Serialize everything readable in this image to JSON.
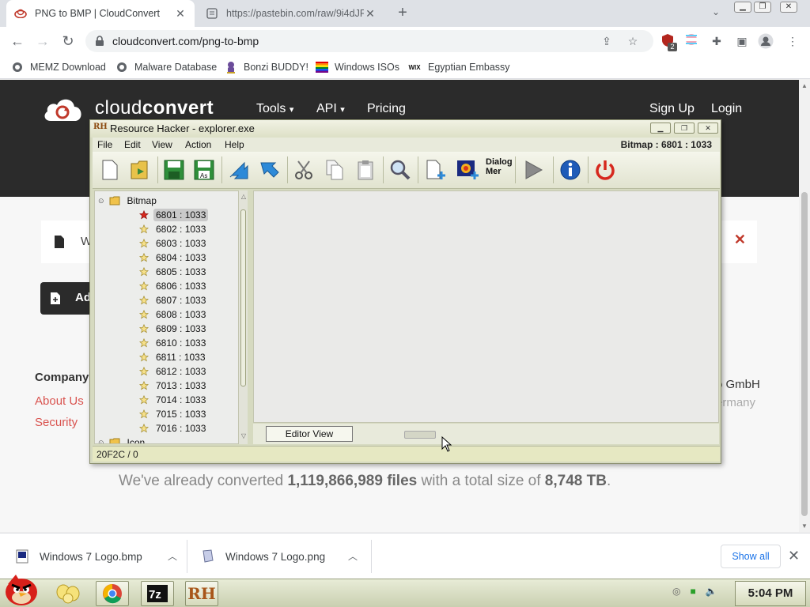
{
  "browser": {
    "tabs": [
      {
        "title": "PNG to BMP | CloudConvert",
        "active": true
      },
      {
        "title": "https://pastebin.com/raw/9i4dJF",
        "active": false
      }
    ],
    "new_tab_symbol": "+",
    "url": "cloudconvert.com/png-to-bmp",
    "extension_badge": "2",
    "bookmarks": [
      "MEMZ Download",
      "Malware Database",
      "Bonzi BUDDY!",
      "Windows ISOs",
      "Egyptian Embassy"
    ],
    "bookmark_logo_text": "WIX"
  },
  "site": {
    "logo_light": "cloud",
    "logo_bold": "convert",
    "nav": {
      "tools": "Tools",
      "api": "API",
      "pricing": "Pricing",
      "signup": "Sign Up",
      "login": "Login"
    },
    "banner_text": "W",
    "add_button_text": "Ad",
    "footer": {
      "company_heading": "Company",
      "links": [
        "About Us",
        "Security"
      ],
      "gmbh": "o GmbH",
      "germany": "ermany"
    },
    "stats": {
      "prefix": "We've already converted ",
      "files": "1,119,866,989 files",
      "middle": " with a total size of ",
      "size": "8,748 TB",
      "suffix": "."
    }
  },
  "resource_hacker": {
    "logo": "RH",
    "title": "Resource Hacker - explorer.exe",
    "menu": [
      "File",
      "Edit",
      "View",
      "Action",
      "Help"
    ],
    "status_right": "Bitmap : 6801 : 1033",
    "dialog_button_lines": [
      "Dialog",
      "Mer"
    ],
    "tree": {
      "folder": "Bitmap",
      "items": [
        "6801 : 1033",
        "6802 : 1033",
        "6803 : 1033",
        "6804 : 1033",
        "6805 : 1033",
        "6806 : 1033",
        "6807 : 1033",
        "6808 : 1033",
        "6809 : 1033",
        "6810 : 1033",
        "6811 : 1033",
        "6812 : 1033",
        "7013 : 1033",
        "7014 : 1033",
        "7015 : 1033",
        "7016 : 1033"
      ],
      "selected_index": 0,
      "next_folder": "Icon"
    },
    "editor_tab": "Editor View",
    "status_bar": "20F2C / 0"
  },
  "downloads": {
    "items": [
      "Windows 7 Logo.bmp",
      "Windows 7 Logo.png"
    ],
    "show_all": "Show all"
  },
  "taskbar": {
    "clock": "5:04 PM",
    "rh_label": "RH"
  },
  "colors": {
    "site_header": "#2b2b2b",
    "link_red": "#d9534f",
    "rh_frame": "#d6dac0",
    "rh_status": "#e6e8c2",
    "chrome_blue": "#1a73e8"
  }
}
